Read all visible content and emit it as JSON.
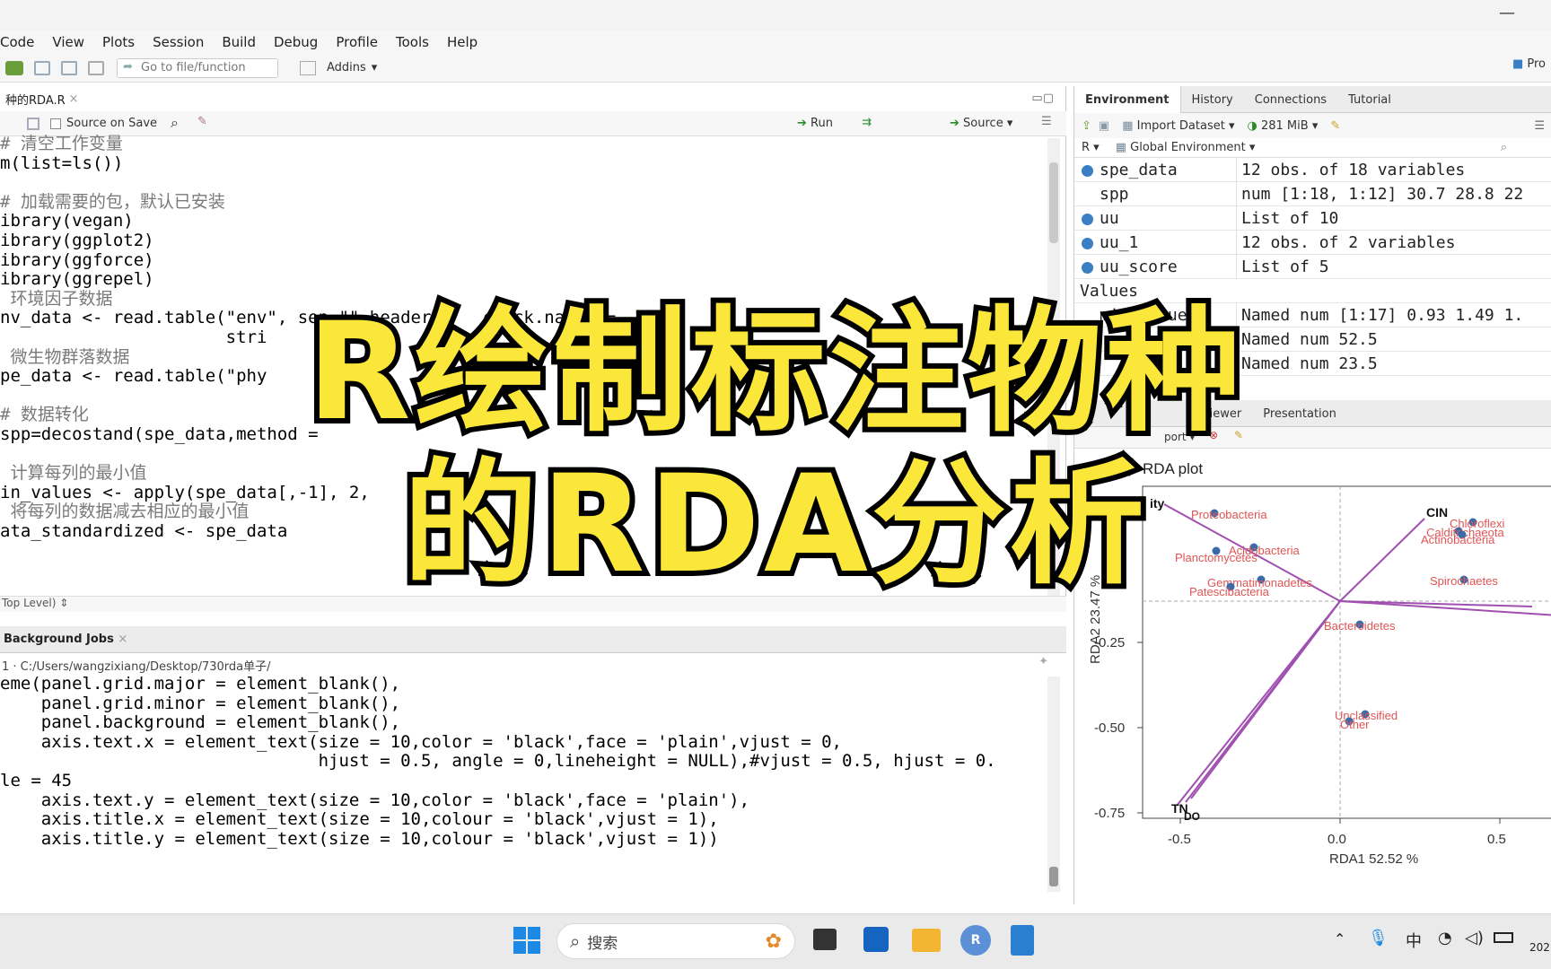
{
  "menubar": {
    "items": [
      "Code",
      "View",
      "Plots",
      "Session",
      "Build",
      "Debug",
      "Profile",
      "Tools",
      "Help"
    ]
  },
  "toolbar": {
    "goto_placeholder": "Go to file/function",
    "addins": "Addins",
    "project": "Pro"
  },
  "editor": {
    "tab_name": "种的RDA.R",
    "source_on_save": "Source on Save",
    "run": "Run",
    "source": "Source",
    "status": "Top Level)",
    "lines": [
      {
        "t": "# 清空工作变量",
        "c": "cmt"
      },
      {
        "t": "m(list=ls())",
        "c": ""
      },
      {
        "t": "",
        "c": ""
      },
      {
        "t": "# 加载需要的包，默认已安装",
        "c": "cmt"
      },
      {
        "t": "ibrary(vegan)",
        "c": ""
      },
      {
        "t": "ibrary(ggplot2)",
        "c": ""
      },
      {
        "t": "ibrary(ggforce)",
        "c": ""
      },
      {
        "t": "ibrary(ggrepel)",
        "c": ""
      },
      {
        "t": " 环境因子数据",
        "c": "cmt"
      },
      {
        "t": "nv_data <- read.table(\"env\", sep=\"\",header =   check.names =              = 1,",
        "c": ""
      },
      {
        "t": "                      stri",
        "c": ""
      },
      {
        "t": " 微生物群落数据",
        "c": "cmt"
      },
      {
        "t": "pe_data <- read.table(\"phy",
        "c": ""
      },
      {
        "t": "",
        "c": ""
      },
      {
        "t": "# 数据转化",
        "c": "cmt"
      },
      {
        "t": "spp=decostand(spe_data,method = ",
        "c": ""
      },
      {
        "t": "",
        "c": ""
      },
      {
        "t": " 计算每列的最小值",
        "c": "cmt"
      },
      {
        "t": "in_values <- apply(spe_data[,-1], 2, ",
        "c": ""
      },
      {
        "t": " 将每列的数据减去相应的最小值",
        "c": "cmt"
      },
      {
        "t": "ata_standardized <- spe_data",
        "c": ""
      }
    ]
  },
  "console": {
    "tab": "Background Jobs",
    "path": "1 · C:/Users/wangzixiang/Desktop/730rda单子/",
    "lines": [
      "eme(panel.grid.major = element_blank(),",
      "    panel.grid.minor = element_blank(),",
      "    panel.background = element_blank(),",
      "    axis.text.x = element_text(size = 10,color = 'black',face = 'plain',vjust = 0,",
      "                               hjust = 0.5, angle = 0,lineheight = NULL),#vjust = 0.5, hjust = 0.",
      "le = 45",
      "    axis.text.y = element_text(size = 10,color = 'black',face = 'plain'),",
      "    axis.title.x = element_text(size = 10,colour = 'black',vjust = 1),",
      "    axis.title.y = element_text(size = 10,colour = 'black',vjust = 1))"
    ]
  },
  "environment": {
    "tabs": [
      "Environment",
      "History",
      "Connections",
      "Tutorial"
    ],
    "import": "Import Dataset",
    "memory": "281 MiB",
    "scope": "Global Environment",
    "lang": "R",
    "rows": [
      {
        "name": "spe_data",
        "value": "12 obs. of 18 variables",
        "icon": true
      },
      {
        "name": "spp",
        "value": "num [1:18, 1:12] 30.7 28.8 22",
        "icon": false
      },
      {
        "name": "uu",
        "value": "List of  10",
        "icon": true
      },
      {
        "name": "uu_1",
        "value": "12 obs. of 2 variables",
        "icon": true
      },
      {
        "name": "uu_score",
        "value": "List of  5",
        "icon": true
      }
    ],
    "values_header": "Values",
    "value_rows": [
      {
        "name": "min_values",
        "value": "Named num [1:17] 0.93 1.49 1."
      },
      {
        "name": "",
        "value": "Named num 52.5"
      },
      {
        "name": "",
        "value": "Named num 23.5"
      }
    ]
  },
  "plots": {
    "tabs": [
      "Viewer",
      "Presentation"
    ],
    "title": "RDA plot",
    "xlabel": "RDA1 52.52 %",
    "ylabel": "RDA2 23.47 %",
    "xticks": [
      "-0.5",
      "0.0",
      "0.5"
    ],
    "yticks": [
      "-0.25",
      "-0.50",
      "-0.75"
    ],
    "species": [
      "Proteobacteria",
      "Acidobacteria",
      "Planctomycetes",
      "Gemmatimonadetes",
      "Patescibacteria",
      "Chloroflexi",
      "Calditrichaeota",
      "Actinobacteria",
      "Spirochaetes",
      "Bacteroidetes",
      "Unclassified",
      "Other"
    ],
    "env": [
      "CIN",
      "ity",
      "TN",
      "DO"
    ]
  },
  "overlay": {
    "line1": "R绘制标注物种",
    "line2": "的RDA分析"
  },
  "taskbar": {
    "search": "搜索",
    "clock": "202"
  }
}
